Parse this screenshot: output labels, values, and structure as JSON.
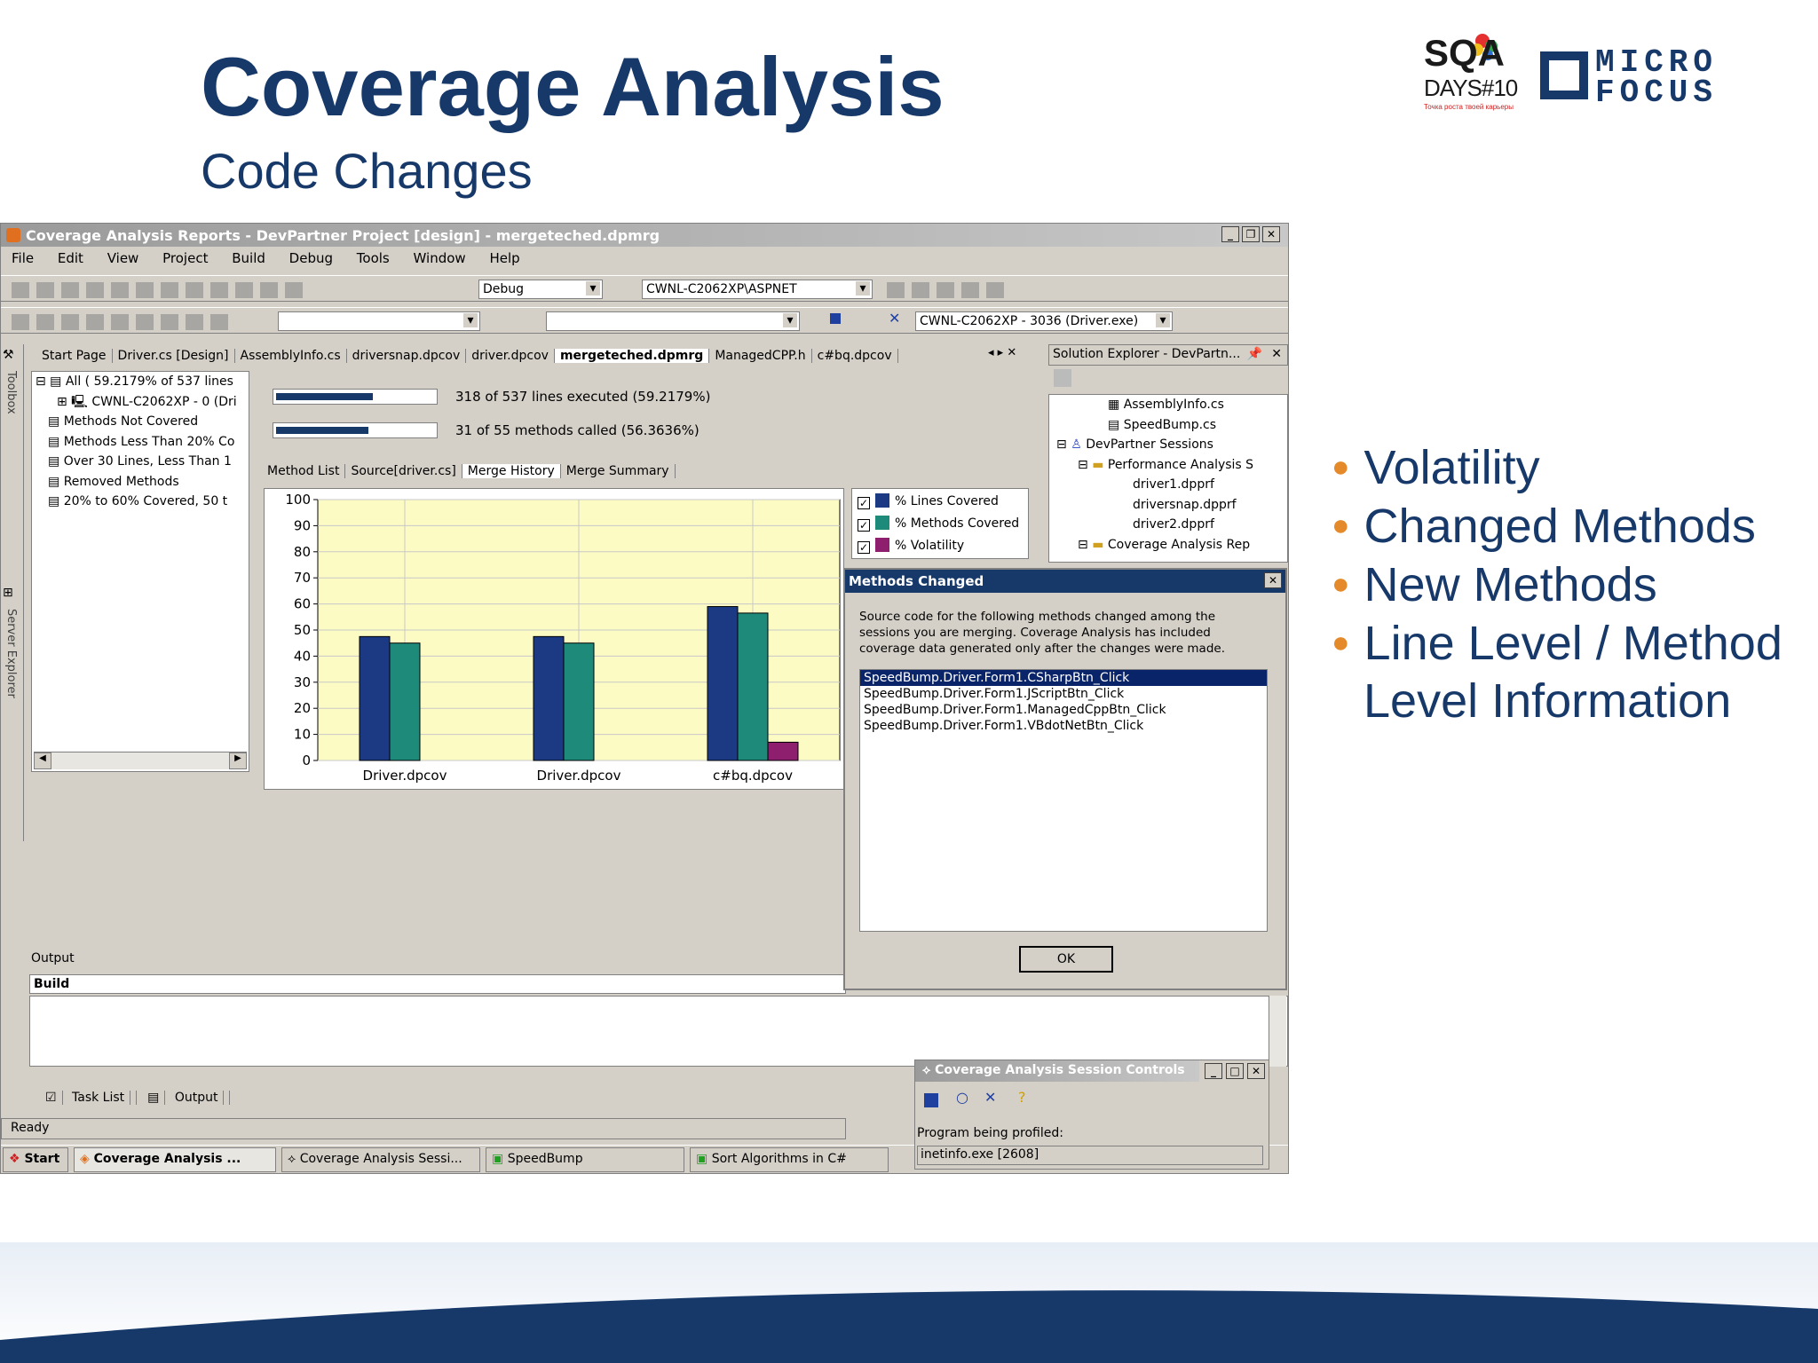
{
  "slide": {
    "title": "Coverage Analysis",
    "subtitle": "Code Changes",
    "bullets": [
      "Volatility",
      "Changed Methods",
      "New Methods",
      "Line Level / Method",
      "Level Information"
    ]
  },
  "logos": {
    "sqa_top": "SQA",
    "sqa_bottom": "DAYS#10",
    "sqa_tagline": "Точка роста твоей карьеры",
    "mf_line1": "MICRO",
    "mf_line2": "FOCUS"
  },
  "window": {
    "title": "Coverage Analysis Reports - DevPartner Project [design] - mergeteched.dpmrg",
    "menu": [
      "File",
      "Edit",
      "View",
      "Project",
      "Build",
      "Debug",
      "Tools",
      "Window",
      "Help"
    ],
    "config_combo": "Debug",
    "path_combo": "CWNL-C2062XP\\ASPNET",
    "process_combo": "CWNL-C2062XP - 3036 (Driver.exe)",
    "side_tabs": [
      "Toolbox",
      "Server Explorer"
    ],
    "doc_tabs": [
      "Start Page",
      "Driver.cs [Design]",
      "AssemblyInfo.cs",
      "driversnap.dpcov",
      "driver.dpcov",
      "mergeteched.dpmrg",
      "ManagedCPP.h",
      "c#bq.dpcov"
    ],
    "tree": [
      "All ( 59.2179% of 537 lines",
      "CWNL-C2062XP - 0 (Dri",
      "Methods Not Covered",
      "Methods Less Than 20% Co",
      "Over 30 Lines, Less Than 1",
      "Removed Methods",
      "20% to 60% Covered, 50 t"
    ],
    "lines_summary": "318 of 537 lines executed (59.2179%)",
    "methods_summary": "31 of 55 methods called (56.3636%)",
    "lines_pct": 0.592,
    "methods_pct": 0.564,
    "sub_tabs": [
      "Method List",
      "Source[driver.cs]",
      "Merge History",
      "Merge Summary"
    ],
    "legend": [
      "% Lines Covered",
      "% Methods Covered",
      "% Volatility"
    ],
    "solution_explorer": {
      "title": "Solution Explorer - DevPartn...",
      "items": [
        "AssemblyInfo.cs",
        "SpeedBump.cs",
        "DevPartner Sessions",
        "Performance Analysis S",
        "driver1.dpprf",
        "driversnap.dpprf",
        "driver2.dpprf",
        "Coverage Analysis Rep"
      ]
    },
    "output_label": "Output",
    "build_label": "Build",
    "bottom_tabs": [
      "Task List",
      "Output"
    ],
    "status": "Ready",
    "taskbar": [
      "Start",
      "Coverage Analysis ...",
      "Coverage Analysis Sessi...",
      "SpeedBump",
      "Sort Algorithms in C#"
    ]
  },
  "dialog": {
    "title": "Methods Changed",
    "text": "Source code for the following methods changed among the sessions you are merging.  Coverage Analysis has included coverage data generated only after the changes were made.",
    "methods": [
      "SpeedBump.Driver.Form1.CSharpBtn_Click",
      "SpeedBump.Driver.Form1.JScriptBtn_Click",
      "SpeedBump.Driver.Form1.ManagedCppBtn_Click",
      "SpeedBump.Driver.Form1.VBdotNetBtn_Click"
    ],
    "ok": "OK"
  },
  "session_controls": {
    "title": "Coverage Analysis Session Controls",
    "label": "Program being profiled:",
    "value": "inetinfo.exe [2608]"
  },
  "colors": {
    "navy": "#17396a",
    "lines": "#1c3a84",
    "methods": "#1e8b7a",
    "volatility": "#8e1e6e",
    "plot_bg": "#fdfbc4",
    "bullet": "#e58a2a"
  },
  "chart_data": {
    "type": "bar",
    "categories": [
      "Driver.dpcov",
      "Driver.dpcov",
      "c#bq.dpcov"
    ],
    "series": [
      {
        "name": "% Lines Covered",
        "values": [
          47.5,
          47.5,
          59
        ]
      },
      {
        "name": "% Methods Covered",
        "values": [
          45,
          45,
          56.5
        ]
      },
      {
        "name": "% Volatility",
        "values": [
          0,
          0,
          7
        ]
      }
    ],
    "yticks": [
      "0",
      "10",
      "20",
      "30",
      "40",
      "50",
      "60",
      "70",
      "80",
      "90",
      "100"
    ],
    "ylim": [
      0,
      100
    ],
    "grid": true,
    "legend": "right"
  }
}
